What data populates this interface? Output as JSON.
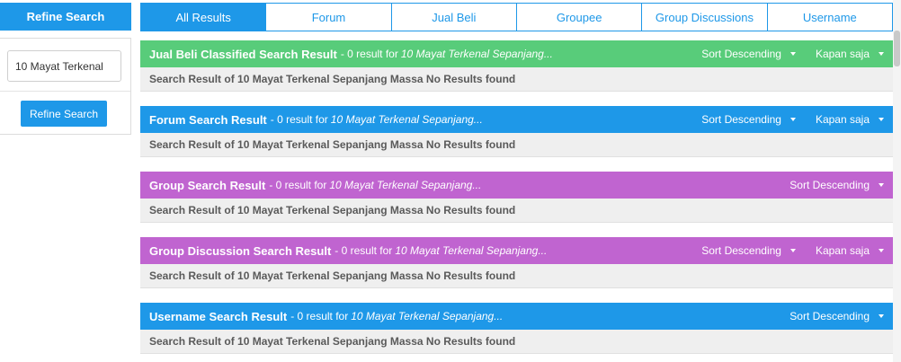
{
  "sidebar": {
    "header": "Refine Search",
    "search_value": "10 Mayat Terkenal",
    "button_label": "Refine Search"
  },
  "tabs": [
    {
      "label": "All Results",
      "active": true
    },
    {
      "label": "Forum",
      "active": false
    },
    {
      "label": "Jual Beli",
      "active": false
    },
    {
      "label": "Groupee",
      "active": false
    },
    {
      "label": "Group Discussions",
      "active": false
    },
    {
      "label": "Username",
      "active": false
    }
  ],
  "sections": [
    {
      "title": "Jual Beli Classified Search Result",
      "count_text": "- 0 result for",
      "query": "10 Mayat Terkenal Sepanjang...",
      "sort": "Sort Descending",
      "time": "Kapan saja",
      "body": "Search Result of 10 Mayat Terkenal Sepanjang Massa No Results found",
      "color": "#58cc7a"
    },
    {
      "title": "Forum Search Result",
      "count_text": "- 0 result for",
      "query": "10 Mayat Terkenal Sepanjang...",
      "sort": "Sort Descending",
      "time": "Kapan saja",
      "body": "Search Result of 10 Mayat Terkenal Sepanjang Massa No Results found",
      "color": "#1e98e8"
    },
    {
      "title": "Group Search Result",
      "count_text": "- 0 result for",
      "query": "10 Mayat Terkenal Sepanjang...",
      "sort": "Sort Descending",
      "body": "Search Result of 10 Mayat Terkenal Sepanjang Massa No Results found",
      "color": "#c064d0"
    },
    {
      "title": "Group Discussion Search Result",
      "count_text": "- 0 result for",
      "query": "10 Mayat Terkenal Sepanjang...",
      "sort": "Sort Descending",
      "time": "Kapan saja",
      "body": "Search Result of 10 Mayat Terkenal Sepanjang Massa No Results found",
      "color": "#c064d0"
    },
    {
      "title": "Username Search Result",
      "count_text": "- 0 result for",
      "query": "10 Mayat Terkenal Sepanjang...",
      "sort": "Sort Descending",
      "body": "Search Result of 10 Mayat Terkenal Sepanjang Massa No Results found",
      "color": "#1e98e8"
    }
  ]
}
